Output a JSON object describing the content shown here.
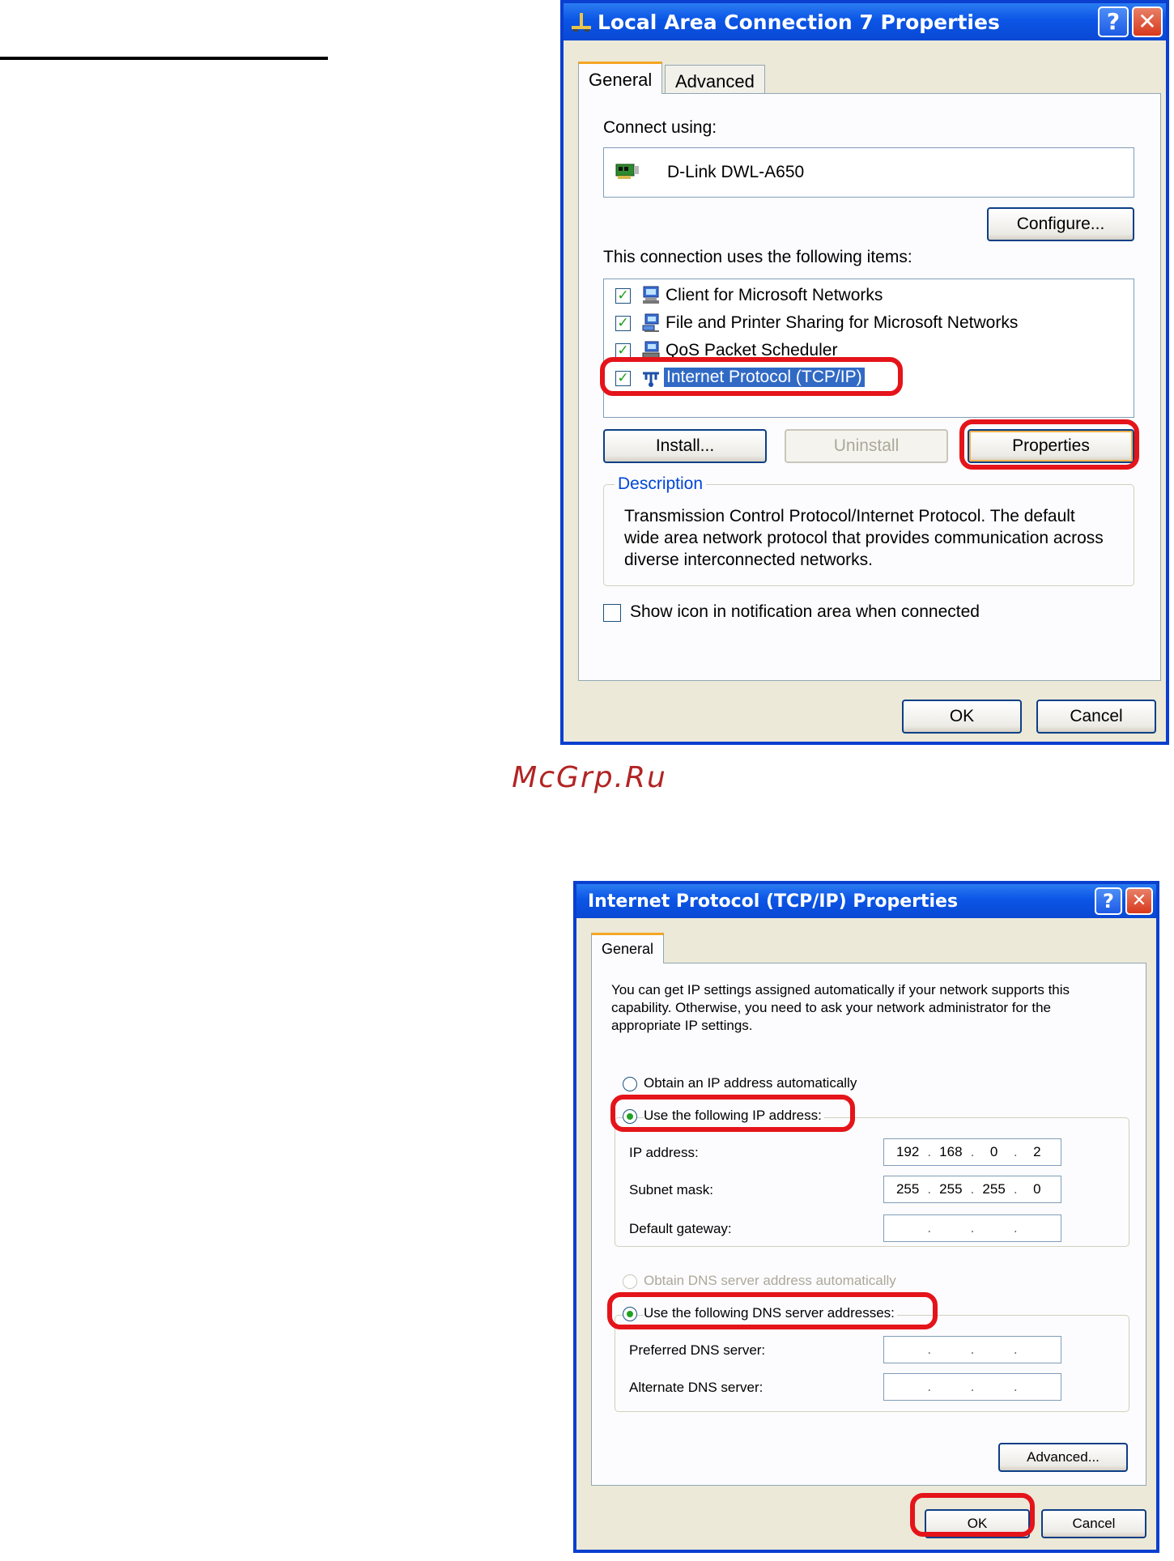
{
  "watermark": "McGrp.Ru",
  "dialog1": {
    "title": "Local Area Connection 7 Properties",
    "help_button": "?",
    "close_button": "✕",
    "tabs": [
      "General",
      "Advanced"
    ],
    "connect_using_label": "Connect using:",
    "adapter_name": "D-Link DWL-A650",
    "configure_button": "Configure...",
    "items_label": "This connection uses the following items:",
    "items": [
      {
        "label": "Client for Microsoft Networks",
        "checked": true,
        "icon": "network-client-icon"
      },
      {
        "label": "File and Printer Sharing for Microsoft Networks",
        "checked": true,
        "icon": "file-sharing-icon"
      },
      {
        "label": "QoS Packet Scheduler",
        "checked": true,
        "icon": "scheduler-icon"
      },
      {
        "label": "Internet Protocol (TCP/IP)",
        "checked": true,
        "icon": "protocol-icon",
        "selected": true
      }
    ],
    "install_button": "Install...",
    "uninstall_button": "Uninstall",
    "properties_button": "Properties",
    "description_title": "Description",
    "description_text": "Transmission Control Protocol/Internet Protocol. The default wide area network protocol that provides communication across diverse interconnected networks.",
    "show_icon_label": "Show icon in notification area when connected",
    "show_icon_checked": false,
    "ok_button": "OK",
    "cancel_button": "Cancel",
    "highlight_color": "#e4141a"
  },
  "dialog2": {
    "title": "Internet Protocol (TCP/IP) Properties",
    "help_button": "?",
    "close_button": "✕",
    "tab": "General",
    "intro_text": "You can get IP settings assigned automatically if your network supports this capability. Otherwise, you need to ask your network administrator for the appropriate IP settings.",
    "obtain_ip_label": "Obtain an IP address automatically",
    "use_ip_label": "Use the following IP address:",
    "ip_address_label": "IP address:",
    "ip_address": [
      "192",
      "168",
      "0",
      "2"
    ],
    "subnet_label": "Subnet mask:",
    "subnet_mask": [
      "255",
      "255",
      "255",
      "0"
    ],
    "gateway_label": "Default gateway:",
    "gateway": [
      "",
      "",
      "",
      ""
    ],
    "obtain_dns_label": "Obtain DNS server address automatically",
    "use_dns_label": "Use the following DNS server addresses:",
    "preferred_dns_label": "Preferred DNS server:",
    "preferred_dns": [
      "",
      "",
      "",
      ""
    ],
    "alternate_dns_label": "Alternate DNS server:",
    "alternate_dns": [
      "",
      "",
      "",
      ""
    ],
    "advanced_button": "Advanced...",
    "ok_button": "OK",
    "cancel_button": "Cancel"
  }
}
